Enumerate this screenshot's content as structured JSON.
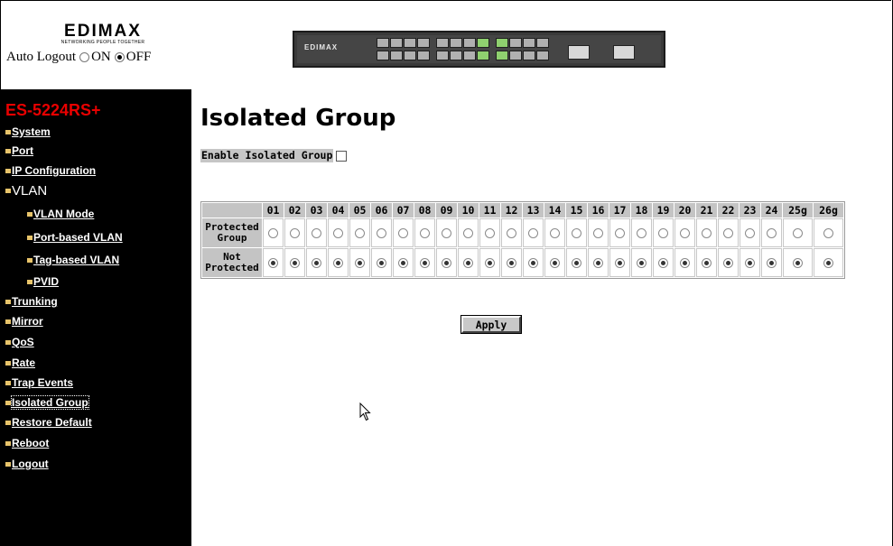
{
  "header": {
    "brand": "EDIMAX",
    "brand_tagline": "NETWORKING PEOPLE TOGETHER",
    "auto_logout": {
      "label": "Auto Logout",
      "options": [
        "ON",
        "OFF"
      ],
      "selected": "OFF"
    },
    "device_brand": "EDIMAX"
  },
  "sidebar": {
    "model": "ES-5224RS+",
    "items": [
      {
        "label": "System"
      },
      {
        "label": "Port"
      },
      {
        "label": "IP Configuration"
      },
      {
        "label": "VLAN"
      },
      {
        "label": "VLAN Mode"
      },
      {
        "label": "Port-based VLAN"
      },
      {
        "label": "Tag-based VLAN"
      },
      {
        "label": "PVID"
      },
      {
        "label": "Trunking"
      },
      {
        "label": "Mirror"
      },
      {
        "label": "QoS"
      },
      {
        "label": "Rate"
      },
      {
        "label": "Trap Events"
      },
      {
        "label": "Isolated Group"
      },
      {
        "label": "Restore Default"
      },
      {
        "label": "Reboot"
      },
      {
        "label": "Logout"
      }
    ],
    "active": "Isolated Group"
  },
  "main": {
    "title": "Isolated Group",
    "enable_label": "Enable Isolated Group",
    "enable_checked": false,
    "ports": [
      "01",
      "02",
      "03",
      "04",
      "05",
      "06",
      "07",
      "08",
      "09",
      "10",
      "11",
      "12",
      "13",
      "14",
      "15",
      "16",
      "17",
      "18",
      "19",
      "20",
      "21",
      "22",
      "23",
      "24",
      "25g",
      "26g"
    ],
    "rows": [
      {
        "label_line1": "Protected",
        "label_line2": "Group",
        "selected": false
      },
      {
        "label_line1": "Not",
        "label_line2": "Protected",
        "selected": true
      }
    ],
    "apply_label": "Apply"
  }
}
